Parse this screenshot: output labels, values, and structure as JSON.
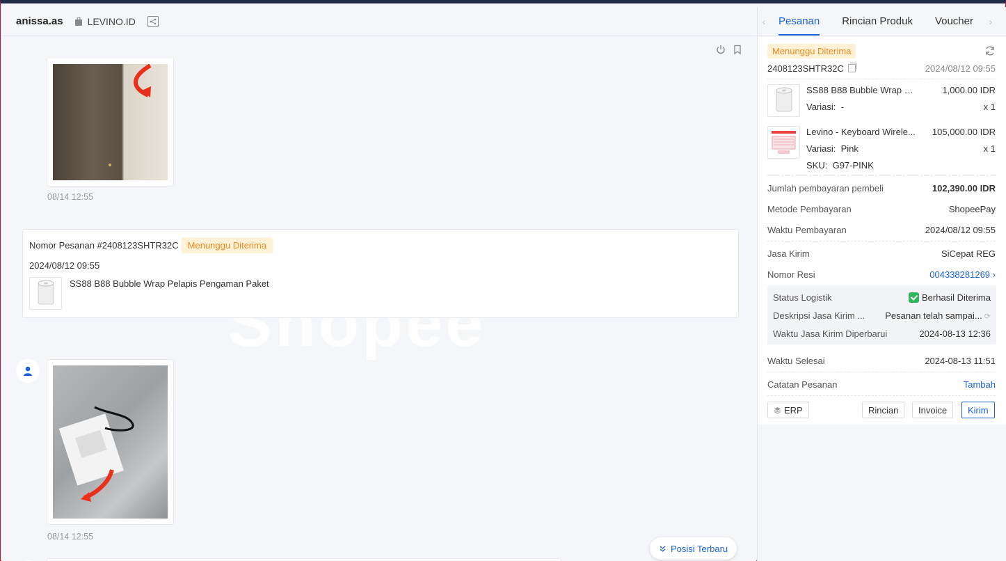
{
  "chat": {
    "buyer_name": "anissa.as",
    "shop_name": "LEVINO.ID",
    "watermark": "Shopee",
    "image1_time": "08/14 12:55",
    "image2_time": "08/14 12:55",
    "order_card": {
      "label": "Nomor Pesanan #2408123SHTR32C",
      "status": "Menunggu Diterima",
      "date": "2024/08/12 09:55",
      "product": "SS88 B88 Bubble Wrap Pelapis Pengaman Paket"
    },
    "latest_button": "Posisi Terbaru"
  },
  "panel": {
    "tabs": [
      "Pesanan",
      "Rincian Produk",
      "Voucher"
    ],
    "status": "Menunggu Diterima",
    "order_id": "2408123SHTR32C",
    "order_time": "2024/08/12 09:55",
    "items": [
      {
        "name": "SS88 B88 Bubble Wrap Pel...",
        "price": "1,000.00 IDR",
        "variation_label": "Variasi:",
        "variation": "-",
        "qty": "x 1"
      },
      {
        "name": "Levino - Keyboard Wirele...",
        "price": "105,000.00 IDR",
        "variation_label": "Variasi:",
        "variation": "Pink",
        "qty": "x 1",
        "sku_label": "SKU:",
        "sku": "G97-PINK"
      }
    ],
    "buyer_payment_label": "Jumlah pembayaran pembeli",
    "buyer_payment": "102,390.00 IDR",
    "payment_method_label": "Metode Pembayaran",
    "payment_method": "ShopeePay",
    "payment_time_label": "Waktu Pembayaran",
    "payment_time": "2024/08/12 09:55",
    "courier_label": "Jasa Kirim",
    "courier": "SiCepat REG",
    "tracking_label": "Nomor Resi",
    "tracking": "004338281269",
    "logistics": {
      "status_label": "Status Logistik",
      "status": "Berhasil Diterima",
      "desc_label": "Deskripsi Jasa Kirim ...",
      "desc": "Pesanan telah sampai...",
      "updated_label": "Waktu Jasa Kirim Diperbarui",
      "updated": "2024-08-13 12:36"
    },
    "completed_label": "Waktu Selesai",
    "completed": "2024-08-13 11:51",
    "note_label": "Catatan Pesanan",
    "note_action": "Tambah",
    "buttons": {
      "erp": "ERP",
      "detail": "Rincian",
      "invoice": "Invoice",
      "send": "Kirim"
    }
  },
  "colors": {
    "accent": "#1a62d6",
    "status_bg": "#fff1d6",
    "status_text": "#f08a24",
    "success": "#2fb55a"
  }
}
